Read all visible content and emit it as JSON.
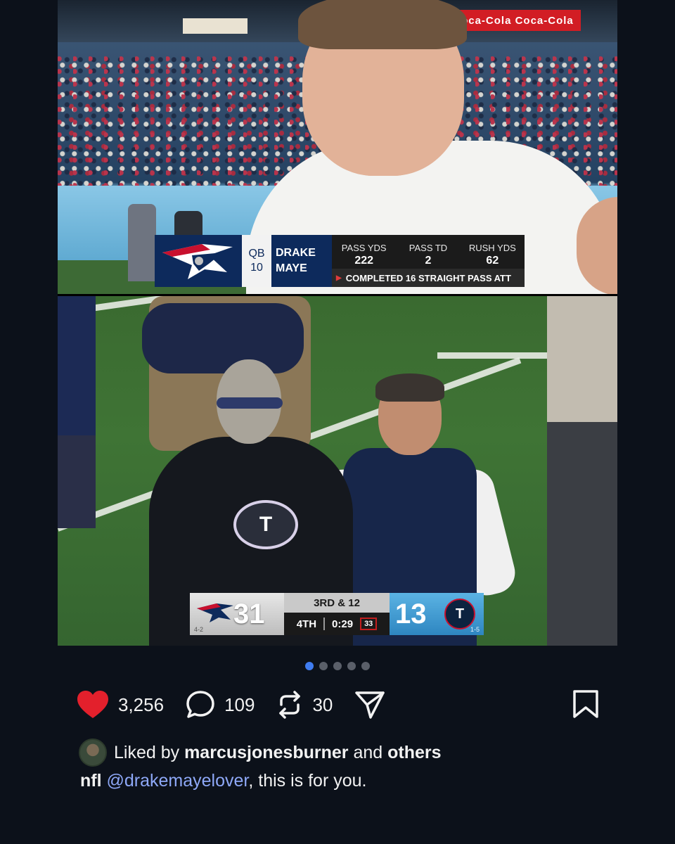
{
  "top_frame": {
    "banner": "Coca-Cola  Coca-Cola",
    "lower_third": {
      "position": "QB",
      "number": "10",
      "first_name": "DRAKE",
      "last_name": "MAYE",
      "stats": [
        {
          "label": "PASS YDS",
          "value": "222"
        },
        {
          "label": "PASS TD",
          "value": "2"
        },
        {
          "label": "RUSH YDS",
          "value": "62"
        }
      ],
      "note": "COMPLETED 16 STRAIGHT PASS ATT"
    }
  },
  "bottom_frame": {
    "coach_logo": "T",
    "scorebug": {
      "away_score": "31",
      "away_record": "4-2",
      "home_score": "13",
      "home_record": "1-5",
      "down_distance": "3RD & 12",
      "quarter": "4TH",
      "clock": "0:29",
      "play_clock": "33"
    }
  },
  "carousel": {
    "count": 5,
    "active_index": 0
  },
  "actions": {
    "likes": "3,256",
    "comments": "109",
    "reposts": "30"
  },
  "liked_by": {
    "prefix": "Liked by",
    "user": "marcusjonesburner",
    "conjunction": "and",
    "others": "others"
  },
  "caption": {
    "author": "nfl",
    "mention": "@drakemayelover",
    "text": ", this is for you."
  },
  "colors": {
    "background": "#0c111a",
    "like": "#e3202c",
    "active_dot": "#3f7cf0",
    "mention": "#8ea8f7"
  }
}
